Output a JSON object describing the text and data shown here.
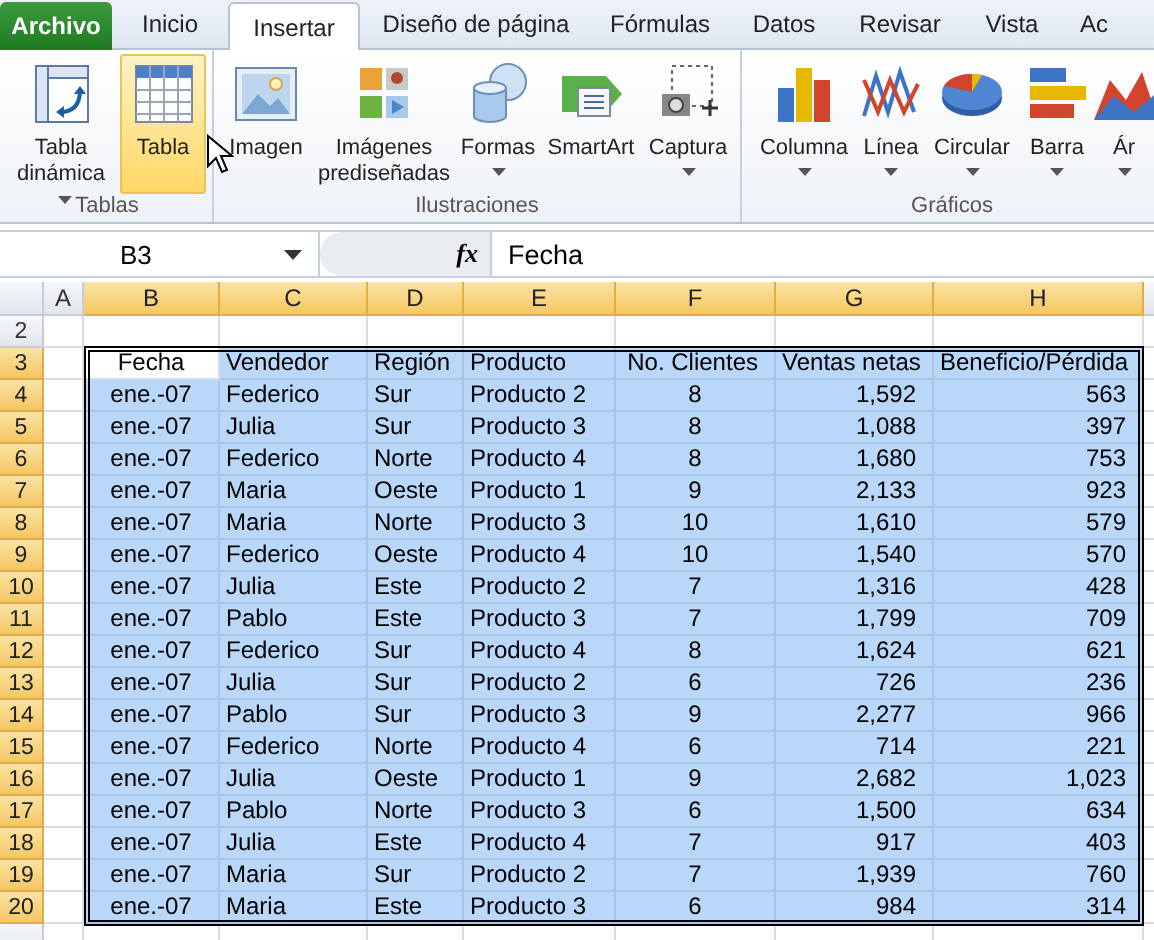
{
  "tabs": [
    {
      "label": "Archivo",
      "kind": "file",
      "selected": false
    },
    {
      "label": "Inicio",
      "kind": "tab",
      "selected": false
    },
    {
      "label": "Insertar",
      "kind": "tab",
      "selected": true
    },
    {
      "label": "Diseño de página",
      "kind": "tab",
      "selected": false
    },
    {
      "label": "Fórmulas",
      "kind": "tab",
      "selected": false
    },
    {
      "label": "Datos",
      "kind": "tab",
      "selected": false
    },
    {
      "label": "Revisar",
      "kind": "tab",
      "selected": false
    },
    {
      "label": "Vista",
      "kind": "tab",
      "selected": false
    },
    {
      "label": "Ac",
      "kind": "tab",
      "selected": false
    }
  ],
  "ribbon": {
    "groups": [
      {
        "label": "Tablas",
        "buttons": [
          {
            "label": "Tabla dinámica",
            "kind": "pivot",
            "dropdown": true,
            "hovered": false
          },
          {
            "label": "Tabla",
            "kind": "table",
            "dropdown": false,
            "hovered": true
          }
        ]
      },
      {
        "label": "Ilustraciones",
        "buttons": [
          {
            "label": "Imagen",
            "kind": "picture",
            "dropdown": false,
            "hovered": false
          },
          {
            "label": "Imágenes prediseñadas",
            "kind": "clipart",
            "dropdown": false,
            "hovered": false
          },
          {
            "label": "Formas",
            "kind": "shapes",
            "dropdown": true,
            "hovered": false
          },
          {
            "label": "SmartArt",
            "kind": "smartart",
            "dropdown": false,
            "hovered": false
          },
          {
            "label": "Captura",
            "kind": "screenshot",
            "dropdown": true,
            "hovered": false
          }
        ]
      },
      {
        "label": "Gráficos",
        "buttons": [
          {
            "label": "Columna",
            "kind": "column",
            "dropdown": true,
            "hovered": false
          },
          {
            "label": "Línea",
            "kind": "line",
            "dropdown": true,
            "hovered": false
          },
          {
            "label": "Circular",
            "kind": "pie",
            "dropdown": true,
            "hovered": false
          },
          {
            "label": "Barra",
            "kind": "bar",
            "dropdown": true,
            "hovered": false
          },
          {
            "label": "Ár",
            "kind": "area",
            "dropdown": true,
            "hovered": false
          }
        ]
      }
    ]
  },
  "formula_bar": {
    "name_box": "B3",
    "function_label": "fx",
    "value": "Fecha"
  },
  "sheet": {
    "columns": [
      {
        "label": "A",
        "selected": false
      },
      {
        "label": "B",
        "selected": true
      },
      {
        "label": "C",
        "selected": true
      },
      {
        "label": "D",
        "selected": true
      },
      {
        "label": "E",
        "selected": true
      },
      {
        "label": "F",
        "selected": true
      },
      {
        "label": "G",
        "selected": true
      },
      {
        "label": "H",
        "selected": true
      }
    ],
    "rows": [
      {
        "number": "2",
        "kind": "blank",
        "selected": false,
        "cells": []
      },
      {
        "number": "3",
        "kind": "header",
        "selected": true,
        "cells": [
          "",
          {
            "text": "Fecha",
            "active": true
          },
          "Vendedor",
          "Región",
          "Producto",
          "No. Clientes",
          "Ventas netas",
          "Beneficio/Pérdida"
        ]
      },
      {
        "number": "4",
        "kind": "data",
        "selected": true,
        "cells": [
          "",
          "ene.-07",
          "Federico",
          "Sur",
          "Producto 2",
          "8",
          "1,592",
          "563"
        ]
      },
      {
        "number": "5",
        "kind": "data",
        "selected": true,
        "cells": [
          "",
          "ene.-07",
          "Julia",
          "Sur",
          "Producto 3",
          "8",
          "1,088",
          "397"
        ]
      },
      {
        "number": "6",
        "kind": "data",
        "selected": true,
        "cells": [
          "",
          "ene.-07",
          "Federico",
          "Norte",
          "Producto 4",
          "8",
          "1,680",
          "753"
        ]
      },
      {
        "number": "7",
        "kind": "data",
        "selected": true,
        "cells": [
          "",
          "ene.-07",
          "Maria",
          "Oeste",
          "Producto 1",
          "9",
          "2,133",
          "923"
        ]
      },
      {
        "number": "8",
        "kind": "data",
        "selected": true,
        "cells": [
          "",
          "ene.-07",
          "Maria",
          "Norte",
          "Producto 3",
          "10",
          "1,610",
          "579"
        ]
      },
      {
        "number": "9",
        "kind": "data",
        "selected": true,
        "cells": [
          "",
          "ene.-07",
          "Federico",
          "Oeste",
          "Producto 4",
          "10",
          "1,540",
          "570"
        ]
      },
      {
        "number": "10",
        "kind": "data",
        "selected": true,
        "cells": [
          "",
          "ene.-07",
          "Julia",
          "Este",
          "Producto 2",
          "7",
          "1,316",
          "428"
        ]
      },
      {
        "number": "11",
        "kind": "data",
        "selected": true,
        "cells": [
          "",
          "ene.-07",
          "Pablo",
          "Este",
          "Producto 3",
          "7",
          "1,799",
          "709"
        ]
      },
      {
        "number": "12",
        "kind": "data",
        "selected": true,
        "cells": [
          "",
          "ene.-07",
          "Federico",
          "Sur",
          "Producto 4",
          "8",
          "1,624",
          "621"
        ]
      },
      {
        "number": "13",
        "kind": "data",
        "selected": true,
        "cells": [
          "",
          "ene.-07",
          "Julia",
          "Sur",
          "Producto 2",
          "6",
          "726",
          "236"
        ]
      },
      {
        "number": "14",
        "kind": "data",
        "selected": true,
        "cells": [
          "",
          "ene.-07",
          "Pablo",
          "Sur",
          "Producto 3",
          "9",
          "2,277",
          "966"
        ]
      },
      {
        "number": "15",
        "kind": "data",
        "selected": true,
        "cells": [
          "",
          "ene.-07",
          "Federico",
          "Norte",
          "Producto 4",
          "6",
          "714",
          "221"
        ]
      },
      {
        "number": "16",
        "kind": "data",
        "selected": true,
        "cells": [
          "",
          "ene.-07",
          "Julia",
          "Oeste",
          "Producto 1",
          "9",
          "2,682",
          "1,023"
        ]
      },
      {
        "number": "17",
        "kind": "data",
        "selected": true,
        "cells": [
          "",
          "ene.-07",
          "Pablo",
          "Norte",
          "Producto 3",
          "6",
          "1,500",
          "634"
        ]
      },
      {
        "number": "18",
        "kind": "data",
        "selected": true,
        "cells": [
          "",
          "ene.-07",
          "Julia",
          "Este",
          "Producto 4",
          "7",
          "917",
          "403"
        ]
      },
      {
        "number": "19",
        "kind": "data",
        "selected": true,
        "cells": [
          "",
          "ene.-07",
          "Maria",
          "Sur",
          "Producto 2",
          "7",
          "1,939",
          "760"
        ]
      },
      {
        "number": "20",
        "kind": "data",
        "selected": true,
        "cells": [
          "",
          "ene.-07",
          "Maria",
          "Este",
          "Producto 3",
          "6",
          "984",
          "314"
        ]
      }
    ]
  }
}
